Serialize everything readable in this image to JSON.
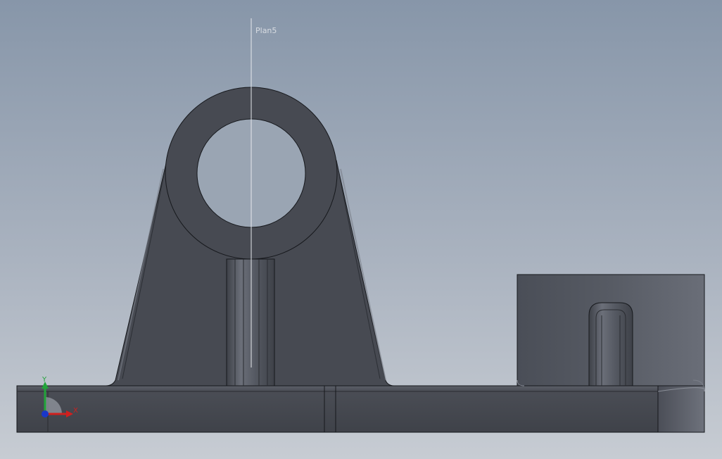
{
  "viewport": {
    "reference_plane_label": "Plan5"
  },
  "triad": {
    "x_label": "X",
    "y_label": "Y",
    "x_color": "#d0201e",
    "y_color": "#22a43a",
    "z_color": "#1a37c8"
  },
  "model": {
    "face_color": "#474a52",
    "edge_color": "#16181c",
    "background_top": "#8796a9",
    "background_bottom": "#c7ccd3"
  }
}
